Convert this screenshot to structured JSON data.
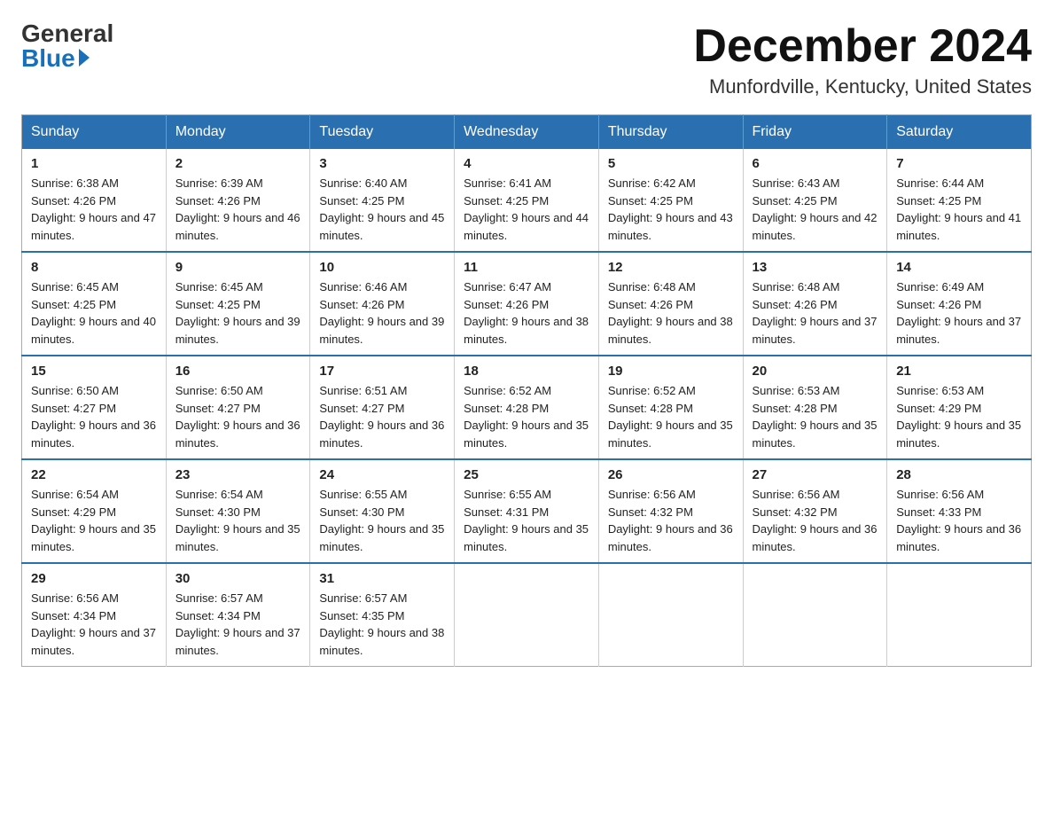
{
  "header": {
    "logo_general": "General",
    "logo_blue": "Blue",
    "month_title": "December 2024",
    "location": "Munfordville, Kentucky, United States"
  },
  "weekdays": [
    "Sunday",
    "Monday",
    "Tuesday",
    "Wednesday",
    "Thursday",
    "Friday",
    "Saturday"
  ],
  "weeks": [
    [
      {
        "day": "1",
        "sunrise": "6:38 AM",
        "sunset": "4:26 PM",
        "daylight": "9 hours and 47 minutes."
      },
      {
        "day": "2",
        "sunrise": "6:39 AM",
        "sunset": "4:26 PM",
        "daylight": "9 hours and 46 minutes."
      },
      {
        "day": "3",
        "sunrise": "6:40 AM",
        "sunset": "4:25 PM",
        "daylight": "9 hours and 45 minutes."
      },
      {
        "day": "4",
        "sunrise": "6:41 AM",
        "sunset": "4:25 PM",
        "daylight": "9 hours and 44 minutes."
      },
      {
        "day": "5",
        "sunrise": "6:42 AM",
        "sunset": "4:25 PM",
        "daylight": "9 hours and 43 minutes."
      },
      {
        "day": "6",
        "sunrise": "6:43 AM",
        "sunset": "4:25 PM",
        "daylight": "9 hours and 42 minutes."
      },
      {
        "day": "7",
        "sunrise": "6:44 AM",
        "sunset": "4:25 PM",
        "daylight": "9 hours and 41 minutes."
      }
    ],
    [
      {
        "day": "8",
        "sunrise": "6:45 AM",
        "sunset": "4:25 PM",
        "daylight": "9 hours and 40 minutes."
      },
      {
        "day": "9",
        "sunrise": "6:45 AM",
        "sunset": "4:25 PM",
        "daylight": "9 hours and 39 minutes."
      },
      {
        "day": "10",
        "sunrise": "6:46 AM",
        "sunset": "4:26 PM",
        "daylight": "9 hours and 39 minutes."
      },
      {
        "day": "11",
        "sunrise": "6:47 AM",
        "sunset": "4:26 PM",
        "daylight": "9 hours and 38 minutes."
      },
      {
        "day": "12",
        "sunrise": "6:48 AM",
        "sunset": "4:26 PM",
        "daylight": "9 hours and 38 minutes."
      },
      {
        "day": "13",
        "sunrise": "6:48 AM",
        "sunset": "4:26 PM",
        "daylight": "9 hours and 37 minutes."
      },
      {
        "day": "14",
        "sunrise": "6:49 AM",
        "sunset": "4:26 PM",
        "daylight": "9 hours and 37 minutes."
      }
    ],
    [
      {
        "day": "15",
        "sunrise": "6:50 AM",
        "sunset": "4:27 PM",
        "daylight": "9 hours and 36 minutes."
      },
      {
        "day": "16",
        "sunrise": "6:50 AM",
        "sunset": "4:27 PM",
        "daylight": "9 hours and 36 minutes."
      },
      {
        "day": "17",
        "sunrise": "6:51 AM",
        "sunset": "4:27 PM",
        "daylight": "9 hours and 36 minutes."
      },
      {
        "day": "18",
        "sunrise": "6:52 AM",
        "sunset": "4:28 PM",
        "daylight": "9 hours and 35 minutes."
      },
      {
        "day": "19",
        "sunrise": "6:52 AM",
        "sunset": "4:28 PM",
        "daylight": "9 hours and 35 minutes."
      },
      {
        "day": "20",
        "sunrise": "6:53 AM",
        "sunset": "4:28 PM",
        "daylight": "9 hours and 35 minutes."
      },
      {
        "day": "21",
        "sunrise": "6:53 AM",
        "sunset": "4:29 PM",
        "daylight": "9 hours and 35 minutes."
      }
    ],
    [
      {
        "day": "22",
        "sunrise": "6:54 AM",
        "sunset": "4:29 PM",
        "daylight": "9 hours and 35 minutes."
      },
      {
        "day": "23",
        "sunrise": "6:54 AM",
        "sunset": "4:30 PM",
        "daylight": "9 hours and 35 minutes."
      },
      {
        "day": "24",
        "sunrise": "6:55 AM",
        "sunset": "4:30 PM",
        "daylight": "9 hours and 35 minutes."
      },
      {
        "day": "25",
        "sunrise": "6:55 AM",
        "sunset": "4:31 PM",
        "daylight": "9 hours and 35 minutes."
      },
      {
        "day": "26",
        "sunrise": "6:56 AM",
        "sunset": "4:32 PM",
        "daylight": "9 hours and 36 minutes."
      },
      {
        "day": "27",
        "sunrise": "6:56 AM",
        "sunset": "4:32 PM",
        "daylight": "9 hours and 36 minutes."
      },
      {
        "day": "28",
        "sunrise": "6:56 AM",
        "sunset": "4:33 PM",
        "daylight": "9 hours and 36 minutes."
      }
    ],
    [
      {
        "day": "29",
        "sunrise": "6:56 AM",
        "sunset": "4:34 PM",
        "daylight": "9 hours and 37 minutes."
      },
      {
        "day": "30",
        "sunrise": "6:57 AM",
        "sunset": "4:34 PM",
        "daylight": "9 hours and 37 minutes."
      },
      {
        "day": "31",
        "sunrise": "6:57 AM",
        "sunset": "4:35 PM",
        "daylight": "9 hours and 38 minutes."
      },
      null,
      null,
      null,
      null
    ]
  ]
}
